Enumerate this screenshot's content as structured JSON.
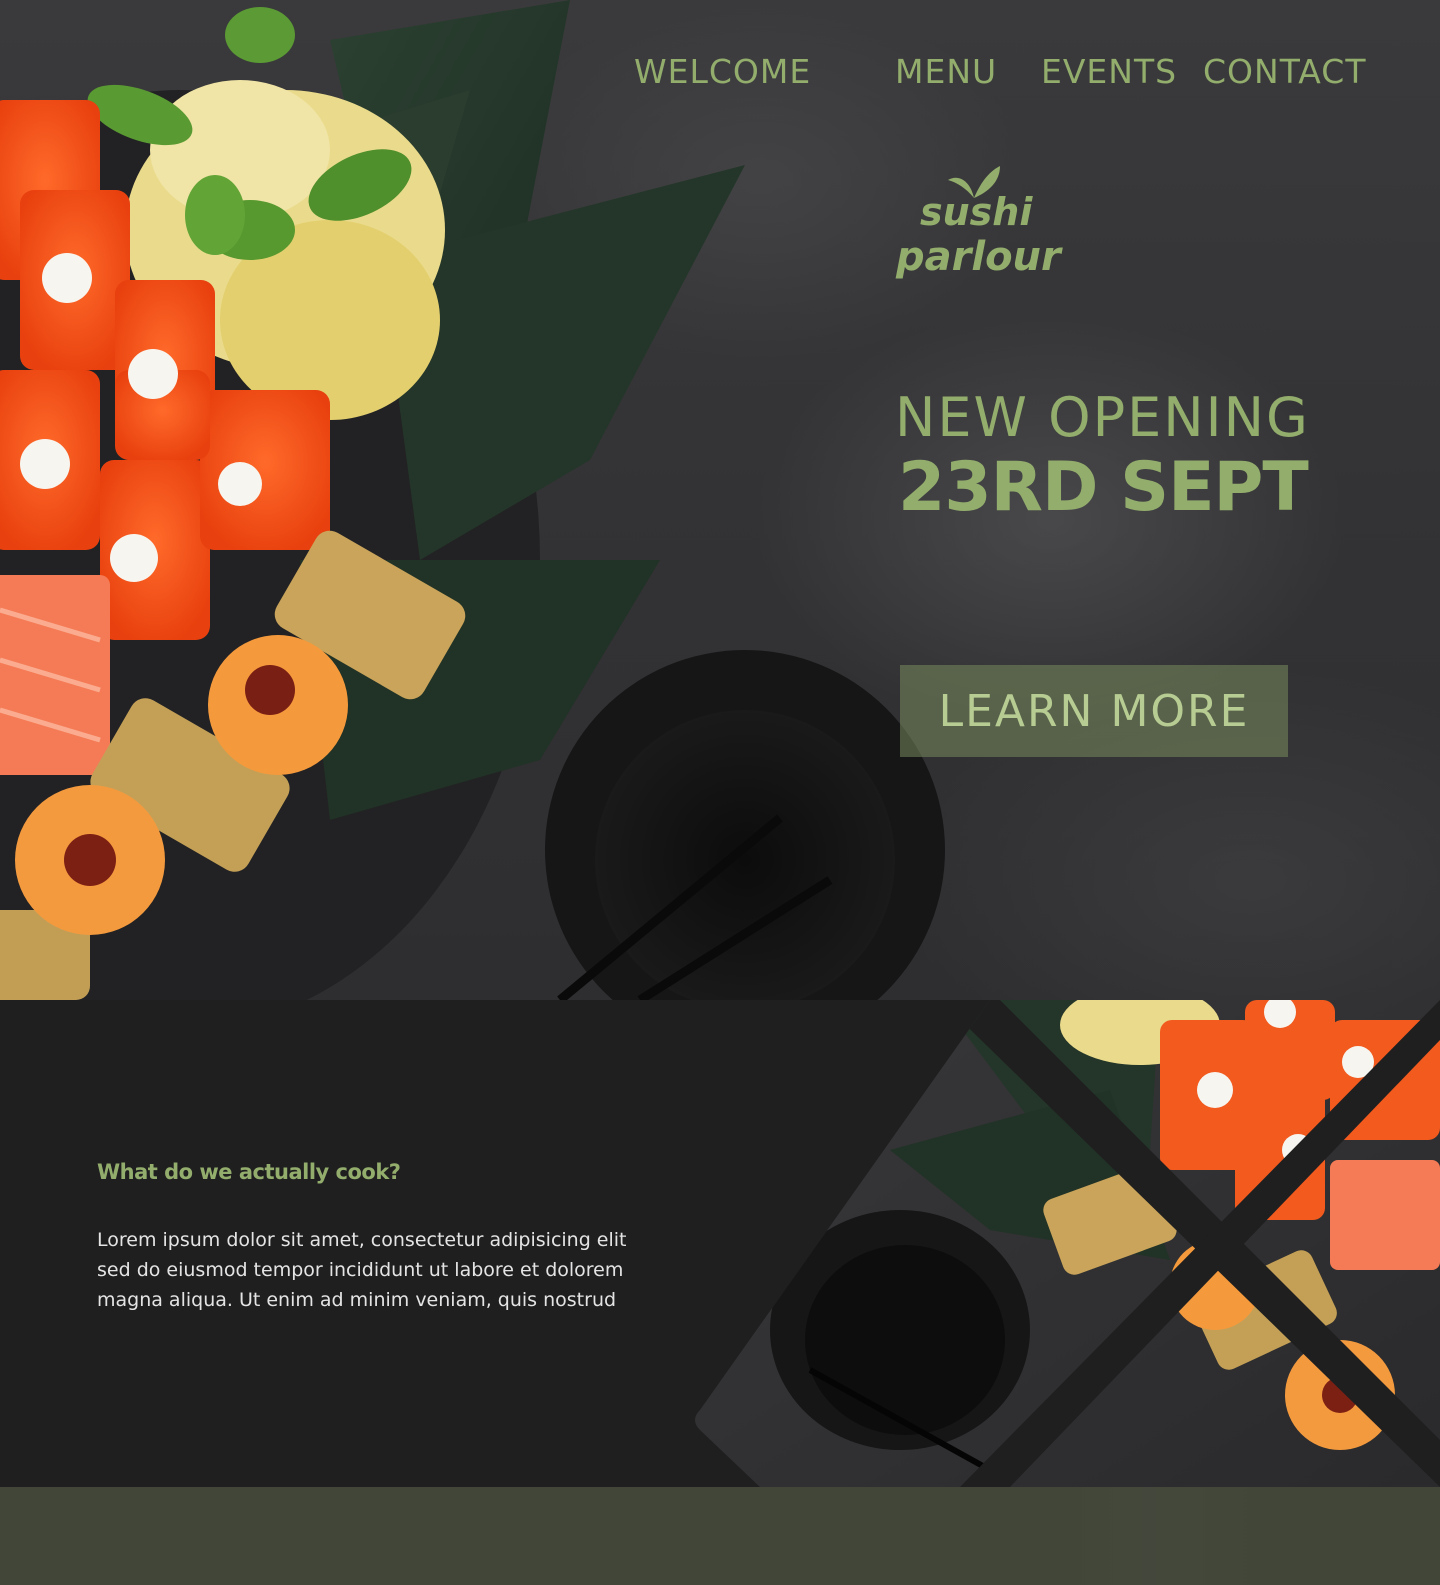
{
  "nav": {
    "items": [
      {
        "label": "WELCOME"
      },
      {
        "label": "MENU"
      },
      {
        "label": "EVENTS"
      },
      {
        "label": "CONTACT"
      }
    ]
  },
  "logo": {
    "line1": "sushi",
    "line2": "parlour",
    "icon": "leaf-icon"
  },
  "hero": {
    "headline": "NEW OPENING",
    "date": "23RD SEPT",
    "cta_label": "LEARN MORE"
  },
  "about": {
    "heading": "What do we actually cook?",
    "body": "Lorem ipsum dolor sit amet, consectetur adipisicing elit sed do eiusmod tempor incididunt ut labore et dolorem magna aliqua. Ut enim ad minim veniam, quis nostrud"
  },
  "colors": {
    "accent": "#93ad6c",
    "dark_bg": "#1f1f20",
    "band_bg": "#424638",
    "hero_bg": "#343436"
  }
}
